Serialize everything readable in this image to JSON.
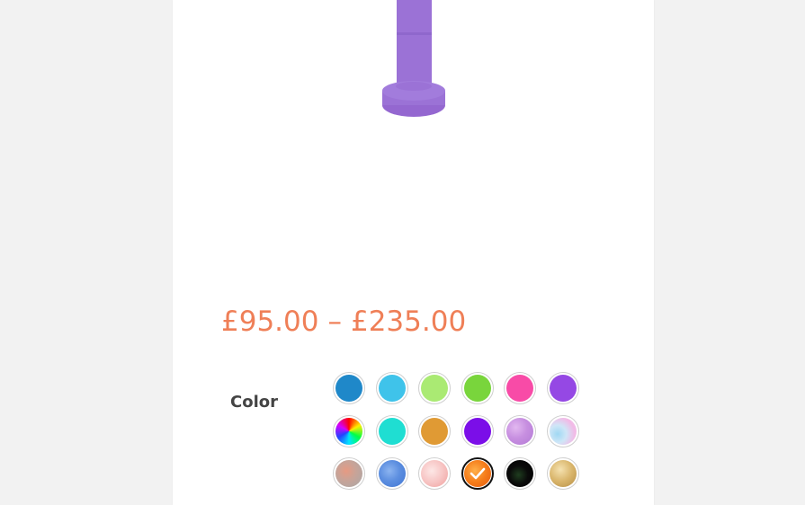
{
  "product": {
    "image_icon": "purple-pipe-product",
    "image_color": "#9b72d6",
    "price_low": "£95.00",
    "price_sep": "–",
    "price_high": "£235.00",
    "price_color": "#ef7f57"
  },
  "variation": {
    "label": "Color",
    "selected_index": 15,
    "swatches": [
      {
        "icon": "swatch-blue",
        "fill": "#1f88c9"
      },
      {
        "icon": "swatch-sky-blue",
        "fill": "#3fc3ea"
      },
      {
        "icon": "swatch-light-green",
        "fill": "#aaea73"
      },
      {
        "icon": "swatch-green",
        "fill": "#79d53c"
      },
      {
        "icon": "swatch-pink",
        "fill": "#f84ba7"
      },
      {
        "icon": "swatch-purple",
        "fill": "#9548e4"
      },
      {
        "icon": "swatch-rainbow",
        "fill": "rainbow"
      },
      {
        "icon": "swatch-turquoise",
        "fill": "#1fded2"
      },
      {
        "icon": "swatch-orange-yellow",
        "fill": "#e09a34"
      },
      {
        "icon": "swatch-violet",
        "fill": "#7b0ee8"
      },
      {
        "icon": "swatch-lavender-marble",
        "fill": "marble-lavender"
      },
      {
        "icon": "swatch-cotton-candy-marble",
        "fill": "marble-cotton"
      },
      {
        "icon": "swatch-coral-grey-marble",
        "fill": "marble-coral"
      },
      {
        "icon": "swatch-blue-marble",
        "fill": "marble-blue"
      },
      {
        "icon": "swatch-pink-marble",
        "fill": "marble-pink"
      },
      {
        "icon": "swatch-orange-marble",
        "fill": "marble-orange"
      },
      {
        "icon": "swatch-black-green-marble",
        "fill": "marble-black"
      },
      {
        "icon": "swatch-gold",
        "fill": "gold"
      }
    ]
  }
}
